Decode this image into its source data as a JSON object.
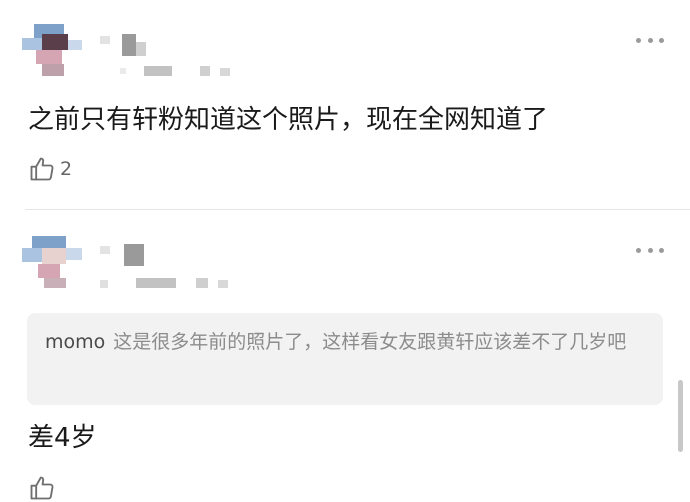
{
  "comments": [
    {
      "text": "之前只有轩粉知道这个照片，现在全网知道了",
      "likes": "2"
    },
    {
      "quote": {
        "author": "momo",
        "text": "这是很多年前的照片了，这样看女友跟黄轩应该差不了几岁吧"
      },
      "text": "差4岁"
    }
  ],
  "icons": {
    "more": "more-dots-icon",
    "like": "thumbs-up-icon"
  },
  "colors": {
    "divider": "#e6e6e6",
    "quote_bg": "#f2f2f2",
    "muted_text": "#8c8c8c"
  }
}
